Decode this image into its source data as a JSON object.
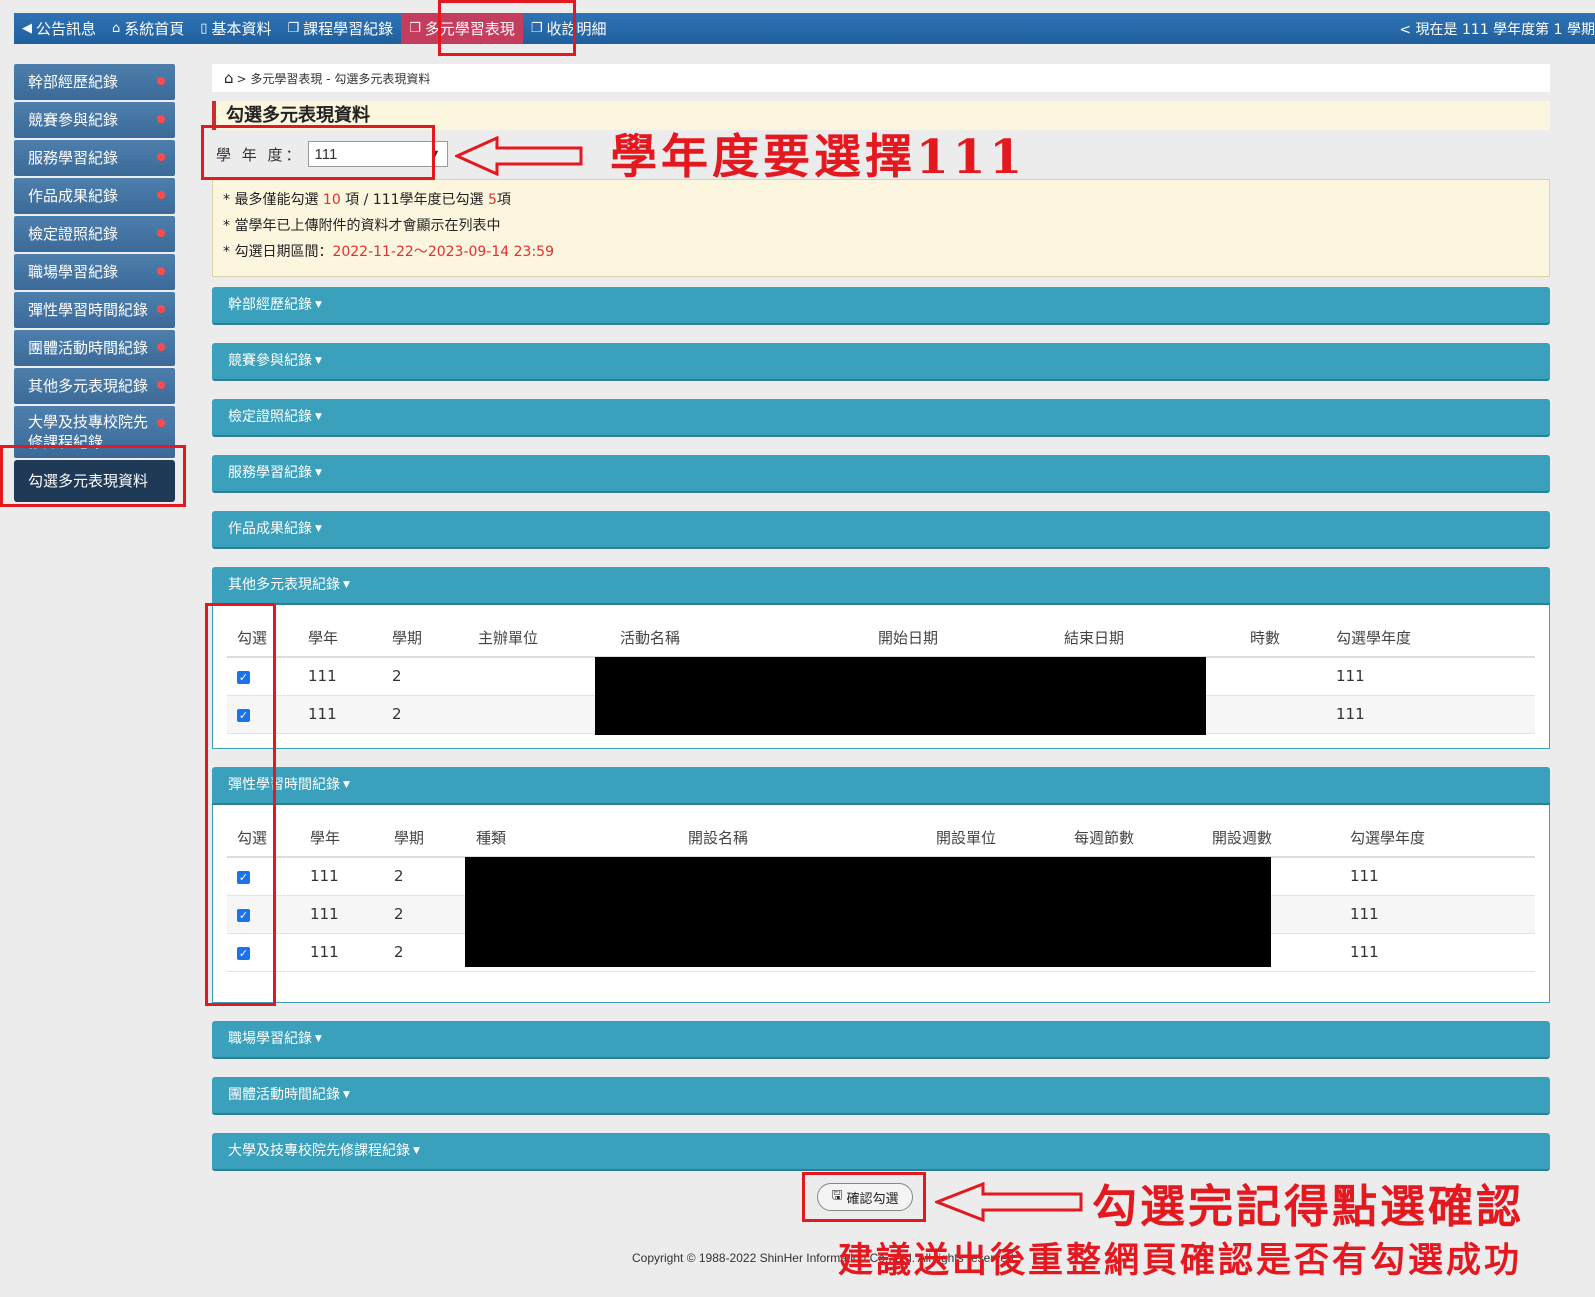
{
  "topnav": {
    "items": [
      {
        "icon": "megaphone-icon",
        "glyph": "📢",
        "label": "公告訊息"
      },
      {
        "icon": "home-icon",
        "glyph": "⌂",
        "label": "系統首頁"
      },
      {
        "icon": "document-icon",
        "glyph": "▯",
        "label": "基本資料"
      },
      {
        "icon": "copy-icon",
        "glyph": "❐",
        "label": "課程學習紀錄"
      },
      {
        "icon": "copy-icon",
        "glyph": "❐",
        "label": "多元學習表現"
      },
      {
        "icon": "copy-icon",
        "glyph": "❐",
        "label": "收訖明細"
      }
    ],
    "semester": "< 現在是 111 學年度第 1 學期"
  },
  "sidebar": {
    "items": [
      {
        "label": "幹部經歷紀錄"
      },
      {
        "label": "競賽參與紀錄"
      },
      {
        "label": "服務學習紀錄"
      },
      {
        "label": "作品成果紀錄"
      },
      {
        "label": "檢定證照紀錄"
      },
      {
        "label": "職場學習紀錄"
      },
      {
        "label": "彈性學習時間紀錄"
      },
      {
        "label": "團體活動時間紀錄"
      },
      {
        "label": "其他多元表現紀錄"
      },
      {
        "label": "大學及技專校院先修課程紀錄"
      },
      {
        "label": "勾選多元表現資料"
      }
    ]
  },
  "breadcrumb": {
    "text": "> 多元學習表現 - 勾選多元表現資料"
  },
  "page_title": "勾選多元表現資料",
  "year": {
    "label": "學 年 度：",
    "value": "111"
  },
  "notice": {
    "l1_a": "* 最多僅能勾選 ",
    "l1_max": "10",
    "l1_b": " 項 / 111學年度已勾選 ",
    "l1_count": "5",
    "l1_c": "項",
    "l2": "* 當學年已上傳附件的資料才會顯示在列表中",
    "l3_a": "* 勾選日期區間：",
    "l3_range": "2022-11-22～2023-09-14 23:59"
  },
  "panels": {
    "cadre": "幹部經歷紀錄",
    "contest": "競賽參與紀錄",
    "license": "檢定證照紀錄",
    "service": "服務學習紀錄",
    "works": "作品成果紀錄",
    "other": "其他多元表現紀錄",
    "flex": "彈性學習時間紀錄",
    "workplace": "職場學習紀錄",
    "group": "團體活動時間紀錄",
    "college": "大學及技專校院先修課程紀錄"
  },
  "other_table": {
    "headers": [
      "勾選",
      "學年",
      "學期",
      "主辦單位",
      "活動名稱",
      "開始日期",
      "結束日期",
      "時數",
      "勾選學年度"
    ],
    "rows": [
      {
        "year": "111",
        "term": "2",
        "pick_year": "111"
      },
      {
        "year": "111",
        "term": "2",
        "pick_year": "111"
      }
    ]
  },
  "flex_table": {
    "headers": [
      "勾選",
      "學年",
      "學期",
      "種類",
      "開設名稱",
      "開設單位",
      "每週節數",
      "開設週數",
      "勾選學年度"
    ],
    "rows": [
      {
        "year": "111",
        "term": "2",
        "pick_year": "111"
      },
      {
        "year": "111",
        "term": "2",
        "pick_year": "111"
      },
      {
        "year": "111",
        "term": "2",
        "pick_year": "111"
      }
    ]
  },
  "confirm_button": "確認勾選",
  "copyright": "Copyright © 1988-2022 ShinHer Information Co., Ltd. All rights reserved.",
  "annotations": {
    "year_note": "學年度要選擇111",
    "confirm_note": "勾選完記得點選確認",
    "refresh_note": "建議送出後重整網頁確認是否有勾選成功"
  },
  "colors": {
    "annotation": "#e4181f",
    "panel": "#3aa0bb",
    "nav": "#1f5f9e",
    "active_nav": "#c43c5e"
  }
}
